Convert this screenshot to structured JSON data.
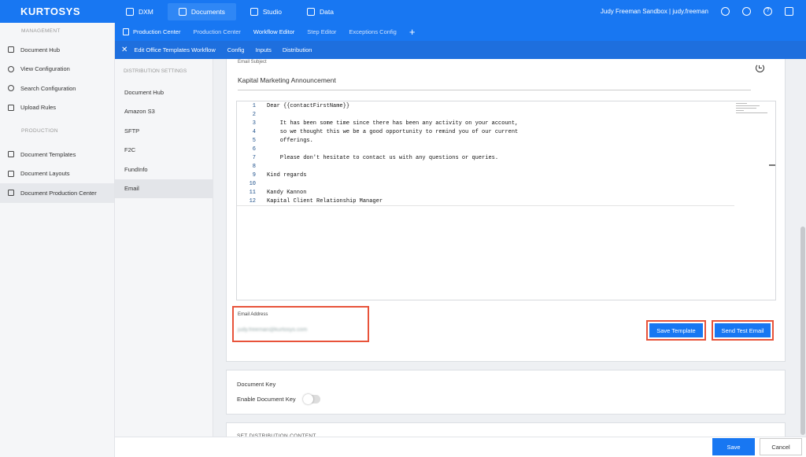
{
  "app": {
    "logo": "KURTOSYS",
    "brand_color": "#1877f2"
  },
  "topnav": [
    {
      "label": "DXM",
      "icon": "layers-icon"
    },
    {
      "label": "Documents",
      "icon": "documents-icon"
    },
    {
      "label": "Studio",
      "icon": "studio-icon"
    },
    {
      "label": "Data",
      "icon": "data-icon"
    }
  ],
  "user": {
    "label": "Judy Freeman Sandbox | judy.freeman"
  },
  "sidebar": {
    "management_label": "MANAGEMENT",
    "management": [
      {
        "label": "Document Hub"
      },
      {
        "label": "View Configuration"
      },
      {
        "label": "Search Configuration"
      },
      {
        "label": "Upload Rules"
      }
    ],
    "production_label": "PRODUCTION",
    "production": [
      {
        "label": "Document Templates"
      },
      {
        "label": "Document Layouts"
      },
      {
        "label": "Document Production Center"
      }
    ]
  },
  "subbar": {
    "tabs": [
      {
        "label": "Production Center"
      },
      {
        "label": "Production Center"
      },
      {
        "label": "Workflow Editor"
      },
      {
        "label": "Step Editor"
      },
      {
        "label": "Exceptions Config"
      }
    ],
    "add": "+"
  },
  "thirdbar": {
    "close": "✕",
    "title": "Edit Office Templates Workflow",
    "tabs": [
      {
        "label": "Config"
      },
      {
        "label": "Inputs"
      },
      {
        "label": "Distribution"
      }
    ]
  },
  "distribution": {
    "heading": "DISTRIBUTION SETTINGS",
    "items": [
      {
        "label": "Document Hub"
      },
      {
        "label": "Amazon S3"
      },
      {
        "label": "SFTP"
      },
      {
        "label": "F2C"
      },
      {
        "label": "FundInfo"
      },
      {
        "label": "Email"
      }
    ]
  },
  "email": {
    "subject_label": "Email Subject",
    "subject_value": "Kapital Marketing Announcement",
    "code_lines": [
      {
        "n": "1",
        "text": "Dear {{contactFirstName}}"
      },
      {
        "n": "2",
        "text": ""
      },
      {
        "n": "3",
        "text": "    It has been some time since there has been any activity on your account,"
      },
      {
        "n": "4",
        "text": "    so we thought this we be a good opportunity to remind you of our current"
      },
      {
        "n": "5",
        "text": "    offerings."
      },
      {
        "n": "6",
        "text": ""
      },
      {
        "n": "7",
        "text": "    Please don't hesitate to contact us with any questions or queries."
      },
      {
        "n": "8",
        "text": ""
      },
      {
        "n": "9",
        "text": "Kind regards"
      },
      {
        "n": "10",
        "text": ""
      },
      {
        "n": "11",
        "text": "Kandy Kannon"
      },
      {
        "n": "12",
        "text": "Kapital Client Relationship Manager"
      }
    ],
    "address_label": "Email Address",
    "address_value": "judy.freeman@kurtosys.com",
    "save_template": "Save Template",
    "send_test": "Send Test Email"
  },
  "document_key": {
    "title": "Document Key",
    "enable_label": "Enable Document Key",
    "enabled": false
  },
  "next_section": {
    "title": "SET DISTRIBUTION CONTENT"
  },
  "footer": {
    "save": "Save",
    "cancel": "Cancel"
  },
  "highlight_color": "#e8533a"
}
